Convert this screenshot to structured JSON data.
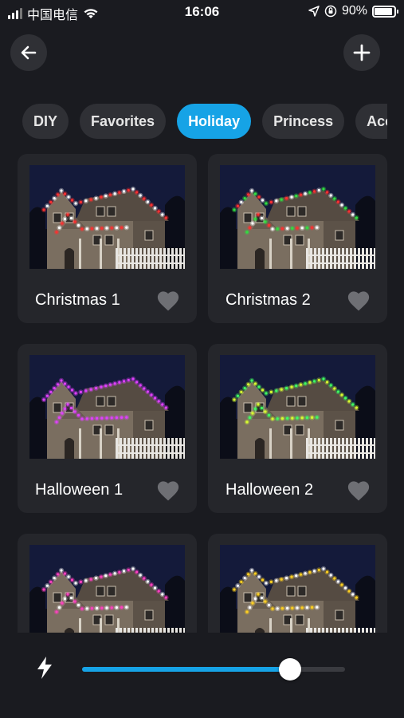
{
  "status_bar": {
    "carrier": "中国电信",
    "time": "16:06",
    "battery_percent": "90%",
    "battery_level": 0.9
  },
  "header": {
    "back_icon": "arrow-left-icon",
    "add_icon": "plus-icon"
  },
  "tabs": [
    {
      "label": "DIY",
      "active": false
    },
    {
      "label": "Favorites",
      "active": false
    },
    {
      "label": "Holiday",
      "active": true
    },
    {
      "label": "Princess",
      "active": false
    },
    {
      "label": "Acce",
      "active": false
    }
  ],
  "scenes": [
    {
      "label": "Christmas 1",
      "favorite": false,
      "light_colors": [
        "#ff3030",
        "#ffffff"
      ]
    },
    {
      "label": "Christmas 2",
      "favorite": false,
      "light_colors": [
        "#30e040",
        "#ff3030",
        "#ffffff"
      ]
    },
    {
      "label": "Halloween 1",
      "favorite": false,
      "light_colors": [
        "#e040ff"
      ]
    },
    {
      "label": "Halloween 2",
      "favorite": false,
      "light_colors": [
        "#d8ff30",
        "#40ff60"
      ]
    },
    {
      "label": "",
      "favorite": false,
      "light_colors": [
        "#ff40c0",
        "#ffffff"
      ]
    },
    {
      "label": "",
      "favorite": false,
      "light_colors": [
        "#ffd020",
        "#ffffff"
      ]
    }
  ],
  "brightness": {
    "icon": "lightning-bolt-icon",
    "value": 0.79
  },
  "colors": {
    "accent": "#16a3e6",
    "background": "#1a1b20",
    "card": "#25262b",
    "pill": "#2f3035"
  }
}
